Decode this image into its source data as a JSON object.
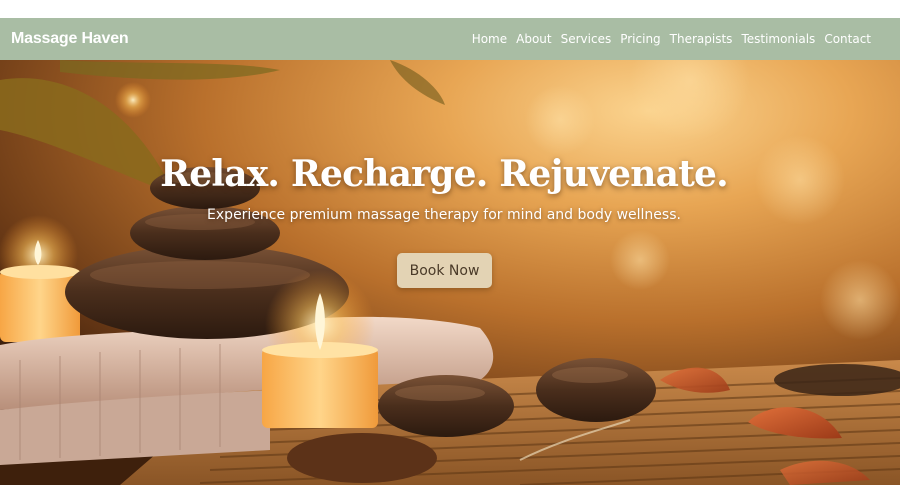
{
  "brand": {
    "name": "Massage Haven"
  },
  "nav": {
    "items": [
      {
        "label": "Home"
      },
      {
        "label": "About"
      },
      {
        "label": "Services"
      },
      {
        "label": "Pricing"
      },
      {
        "label": "Therapists"
      },
      {
        "label": "Testimonials"
      },
      {
        "label": "Contact"
      }
    ]
  },
  "hero": {
    "title": "Relax. Recharge. Rejuvenate.",
    "subtitle": "Experience premium massage therapy for mind and body wellness.",
    "cta_label": "Book Now"
  },
  "colors": {
    "navbar": "#a9bda4",
    "cta_button": "#e3d3b4",
    "cta_text": "#4a3a28"
  }
}
